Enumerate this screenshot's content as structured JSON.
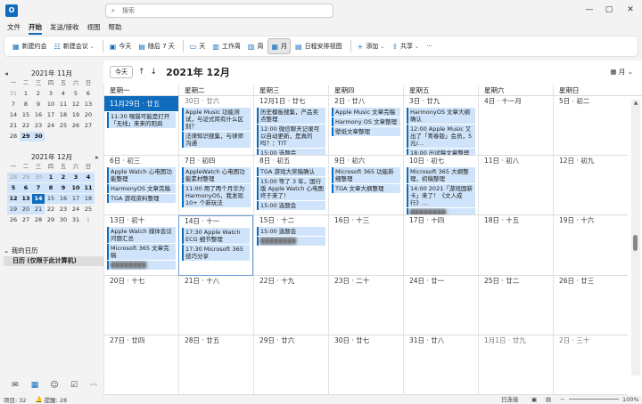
{
  "app": {
    "logo": "O"
  },
  "search": {
    "icon": "search-icon",
    "placeholder": "搜索"
  },
  "window": {
    "min": "—",
    "max": "▢",
    "close": "✕"
  },
  "menu": [
    {
      "label": "文件",
      "active": false
    },
    {
      "label": "开始",
      "active": true
    },
    {
      "label": "发送/接收",
      "active": false
    },
    {
      "label": "视图",
      "active": false
    },
    {
      "label": "帮助",
      "active": false
    }
  ],
  "ribbon": {
    "new_meeting": "新建约会",
    "new_meeting_menu": "新建会议",
    "today": "今天",
    "next7": "随后 7 天",
    "day": "天",
    "work_week": "工作周",
    "week": "周",
    "month": "月",
    "schedule": "日程安排视图",
    "add": "添加",
    "share": "共享",
    "more": "···"
  },
  "mini_nov": {
    "title": "2021年 11月",
    "days": [
      "31",
      "1",
      "2",
      "3",
      "4",
      "5",
      "6",
      "7",
      "8",
      "9",
      "10",
      "11",
      "12",
      "13",
      "14",
      "15",
      "16",
      "17",
      "18",
      "19",
      "20",
      "21",
      "22",
      "23",
      "24",
      "25",
      "26",
      "27",
      "28",
      "29",
      "30"
    ]
  },
  "mini_dec": {
    "title": "2021年 12月",
    "days": [
      "28",
      "29",
      "30",
      "1",
      "2",
      "3",
      "4",
      "5",
      "6",
      "7",
      "8",
      "9",
      "10",
      "11",
      "12",
      "13",
      "14",
      "15",
      "16",
      "17",
      "18",
      "19",
      "20",
      "21",
      "22",
      "23",
      "24",
      "25",
      "26",
      "27",
      "28",
      "29",
      "30",
      "31",
      "1"
    ]
  },
  "weekday_short": [
    "一",
    "二",
    "三",
    "四",
    "五",
    "六",
    "日"
  ],
  "calendars": {
    "group": "我的日历",
    "item": "日历 (仅限于此计算机)"
  },
  "bottom_nav": {
    "mail": "✉",
    "calendar": "▦",
    "people": "☺",
    "tasks": "☑",
    "more": "···"
  },
  "nav": {
    "today": "今天",
    "prev": "↑",
    "next": "↓",
    "title": "2021年 12月",
    "view": "月"
  },
  "weekdays": [
    "星期一",
    "星期二",
    "星期三",
    "星期四",
    "星期五",
    "星期六",
    "星期日"
  ],
  "weeks": [
    [
      {
        "label": "11月29日 · 廿五",
        "selected": true,
        "events": [
          "11:30 喂猫可能是打开「无线」来来的阳肩"
        ]
      },
      {
        "label": "30日 · 廿六",
        "events": [
          "Apple Music 功能测试，与证式简有什么区别？",
          "法律知识搜集，与律师沟通"
        ]
      },
      {
        "label": "12月1日 · 廿七",
        "events": [
          "历史模板搜集，产品卖点整理",
          "12:00 微信聊天记录可以自动更新，是真的吗？：TIT",
          "15:00 选题会"
        ]
      },
      {
        "label": "2日 · 廿八",
        "events": [
          "Apple Music 文章完稿",
          "Harmony OS 文章整理",
          "壁纸文章整理"
        ]
      },
      {
        "label": "3日 · 廿九",
        "events": [
          "HarmonyOS 文章大纲确认",
          "12:00 Apple Music 又出了「青春版」会员，5 元/…",
          "18:00 出试稿文章整理"
        ]
      },
      {
        "label": "4日 · 十一月",
        "events": []
      },
      {
        "label": "5日 · 初二",
        "events": []
      }
    ],
    [
      {
        "label": "6日 · 初三",
        "events": [
          "Apple Watch 心电图功能整理",
          "HarmonyOS 文章完稿",
          "TGA 游戏资料整理"
        ]
      },
      {
        "label": "7日 · 初四",
        "events": [
          "AppleWatch 心电图功能素材整理",
          "11:00 用了两个月华为 HarmonyOS，我发现10+ 个新玩法"
        ]
      },
      {
        "label": "8日 · 初五",
        "events": [
          "TGA 游戏大奖稿确认",
          "15:00 等了 3 年，国行版 Apple Watch 心电图终于来了！",
          "15:00 选题会"
        ]
      },
      {
        "label": "9日 · 初六",
        "events": [
          "Microsoft 365 功能新细整理",
          "TGA 文章大纲整理"
        ]
      },
      {
        "label": "10日 · 初七",
        "events": [
          "Microsoft 365 大纲整理，初稿整理",
          "14:00 2021「游戏国新卡」来了！《文人成行》…",
          "blurred-1"
        ]
      },
      {
        "label": "11日 · 初八",
        "events": []
      },
      {
        "label": "12日 · 初九",
        "events": []
      }
    ],
    [
      {
        "label": "13日 · 初十",
        "events": [
          "Apple Watch 媒体会议问题汇总",
          "Microsoft 365 文章完稿",
          "blurred-2"
        ]
      },
      {
        "label": "14日 · 十一",
        "today": true,
        "events": [
          "17:30 Apple Watch ECG 细节整理",
          "17:30 Microsoft 365 技巧分享"
        ]
      },
      {
        "label": "15日 · 十二",
        "events": [
          "15:00 选题会",
          "blurred-3"
        ]
      },
      {
        "label": "16日 · 十三",
        "events": []
      },
      {
        "label": "17日 · 十四",
        "events": []
      },
      {
        "label": "18日 · 十五",
        "events": []
      },
      {
        "label": "19日 · 十六",
        "events": []
      }
    ],
    [
      {
        "label": "20日 · 十七",
        "events": []
      },
      {
        "label": "21日 · 十八",
        "events": []
      },
      {
        "label": "22日 · 十九",
        "events": []
      },
      {
        "label": "23日 · 二十",
        "events": []
      },
      {
        "label": "24日 · 廿一",
        "events": []
      },
      {
        "label": "25日 · 廿二",
        "events": []
      },
      {
        "label": "26日 · 廿三",
        "events": []
      }
    ],
    [
      {
        "label": "27日 · 廿四",
        "events": []
      },
      {
        "label": "28日 · 廿五",
        "events": []
      },
      {
        "label": "29日 · 廿六",
        "events": []
      },
      {
        "label": "30日 · 廿七",
        "events": []
      },
      {
        "label": "31日 · 廿八",
        "events": []
      },
      {
        "label": "1月1日 · 廿九",
        "events": []
      },
      {
        "label": "2日 · 三十",
        "events": []
      }
    ]
  ],
  "status": {
    "items": "项目: 32",
    "reminders": "提醒: 28",
    "sync": "已连接",
    "zoom": "100%"
  }
}
